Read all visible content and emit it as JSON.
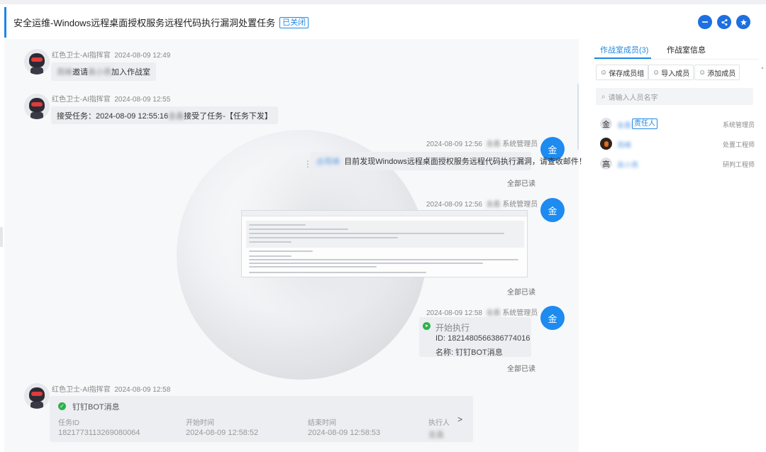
{
  "header": {
    "title": "安全运维-Windows远程桌面授权服务远程代码执行漏洞处置任务",
    "status_badge": "已关闭",
    "icons": [
      "chat-icon",
      "share-icon",
      "star-icon"
    ]
  },
  "messages": [
    {
      "sender": "红色卫士-AI指挥官",
      "time": "2024-08-09 12:49",
      "text_name1": "周峰",
      "text_mid": "邀请",
      "text_name2": "高小燕",
      "text_end": "加入作战室"
    },
    {
      "sender": "红色卫士-AI指挥官",
      "time": "2024-08-09 12:55",
      "text_start": "接受任务：2024-08-09 12:55:16 ",
      "text_name": "金鑫",
      "text_end": "接受了任务-【任务下发】"
    },
    {
      "time": "2024-08-09 12:56",
      "sender_name": "金鑫",
      "role": "系统管理员",
      "mention": "@周峰",
      "text": "目前发现Windows远程桌面授权服务远程代码执行漏洞，请查收邮件！",
      "read": "全部已读",
      "avatar": "金"
    },
    {
      "time": "2024-08-09 12:56",
      "sender_name": "金鑫",
      "role": "系统管理员",
      "read": "全部已读",
      "avatar": "金"
    },
    {
      "time": "2024-08-09 12:58",
      "sender_name": "金鑫",
      "role": "系统管理员",
      "exec_label": "开始执行",
      "exec_id": "ID: 1821480566386774016",
      "exec_name": "名称: 钉钉BOT消息",
      "read": "全部已读",
      "avatar": "金"
    },
    {
      "sender": "红色卫士-AI指挥官",
      "time": "2024-08-09 12:58"
    }
  ],
  "bot_card": {
    "title": "钉钉BOT消息",
    "headers": [
      "任务ID",
      "开始时间",
      "结束时间",
      "执行人"
    ],
    "values": [
      "1821773113269080064",
      "2024-08-09 12:58:52",
      "2024-08-09 12:58:53",
      "金鑫"
    ]
  },
  "right": {
    "tab_members": "作战室成员(3)",
    "tab_info": "作战室信息",
    "btn_save": "保存成员组",
    "btn_import": "导入成员",
    "btn_add": "添加成员",
    "search_placeholder": "请输入人员名字",
    "members": [
      {
        "avatar": "金",
        "name": "金鑫",
        "badge": "责任人",
        "role": "系统管理员"
      },
      {
        "avatar": "",
        "name": "周峰",
        "role": "处置工程师"
      },
      {
        "avatar": "高",
        "name": "高小燕",
        "role": "研判工程师"
      }
    ]
  },
  "colors": {
    "accent": "#1e88e5",
    "success": "#2ab24b",
    "avatar_blue": "#1d8bf0"
  }
}
